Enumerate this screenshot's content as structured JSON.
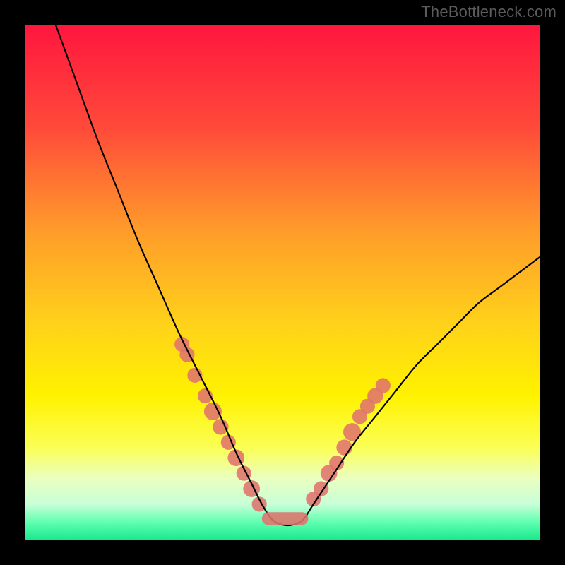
{
  "watermark": "TheBottleneck.com",
  "chart_data": {
    "type": "line",
    "title": "",
    "xlabel": "",
    "ylabel": "",
    "xlim": [
      0,
      100
    ],
    "ylim": [
      0,
      100
    ],
    "grid": false,
    "legend": false,
    "gradient_stops": [
      {
        "offset": 0.0,
        "color": "#ff163e"
      },
      {
        "offset": 0.2,
        "color": "#ff4a3a"
      },
      {
        "offset": 0.4,
        "color": "#ff9c2a"
      },
      {
        "offset": 0.58,
        "color": "#ffd21a"
      },
      {
        "offset": 0.72,
        "color": "#fff200"
      },
      {
        "offset": 0.82,
        "color": "#fbff55"
      },
      {
        "offset": 0.88,
        "color": "#eaffc0"
      },
      {
        "offset": 0.93,
        "color": "#c8ffd8"
      },
      {
        "offset": 0.965,
        "color": "#5fffb0"
      },
      {
        "offset": 1.0,
        "color": "#17e88c"
      }
    ],
    "series": [
      {
        "name": "bottleneck-curve",
        "color": "#000000",
        "x": [
          6,
          10,
          14,
          18,
          22,
          26,
          30,
          34,
          38,
          41,
          44,
          46,
          48,
          50,
          52,
          54,
          56,
          60,
          64,
          68,
          72,
          76,
          80,
          84,
          88,
          92,
          96,
          100
        ],
        "y": [
          100,
          89,
          78,
          68,
          58,
          49,
          40,
          32,
          24,
          17,
          11,
          7,
          4,
          3,
          3,
          4,
          7,
          13,
          19,
          24,
          29,
          34,
          38,
          42,
          46,
          49,
          52,
          55
        ]
      }
    ],
    "markers": [
      {
        "x": 30.5,
        "y": 38,
        "r": 1.0
      },
      {
        "x": 31.5,
        "y": 36,
        "r": 1.0
      },
      {
        "x": 33.0,
        "y": 32,
        "r": 1.0
      },
      {
        "x": 35.0,
        "y": 28,
        "r": 1.0
      },
      {
        "x": 36.5,
        "y": 25,
        "r": 1.3
      },
      {
        "x": 38.0,
        "y": 22,
        "r": 1.1
      },
      {
        "x": 39.5,
        "y": 19,
        "r": 1.0
      },
      {
        "x": 41.0,
        "y": 16,
        "r": 1.2
      },
      {
        "x": 42.5,
        "y": 13,
        "r": 1.0
      },
      {
        "x": 44.0,
        "y": 10,
        "r": 1.2
      },
      {
        "x": 45.5,
        "y": 7,
        "r": 1.0
      },
      {
        "x": 56.0,
        "y": 8,
        "r": 1.0
      },
      {
        "x": 57.5,
        "y": 10,
        "r": 1.0
      },
      {
        "x": 59.0,
        "y": 13,
        "r": 1.2
      },
      {
        "x": 60.5,
        "y": 15,
        "r": 1.0
      },
      {
        "x": 62.0,
        "y": 18,
        "r": 1.1
      },
      {
        "x": 63.5,
        "y": 21,
        "r": 1.3
      },
      {
        "x": 65.0,
        "y": 24,
        "r": 1.0
      },
      {
        "x": 66.5,
        "y": 26,
        "r": 1.0
      },
      {
        "x": 68.0,
        "y": 28,
        "r": 1.1
      },
      {
        "x": 69.5,
        "y": 30,
        "r": 1.0
      }
    ],
    "flat_bottom": {
      "x1": 46,
      "x2": 55,
      "y": 4.2,
      "thickness": 2.5
    },
    "marker_color": "#e0736d"
  }
}
